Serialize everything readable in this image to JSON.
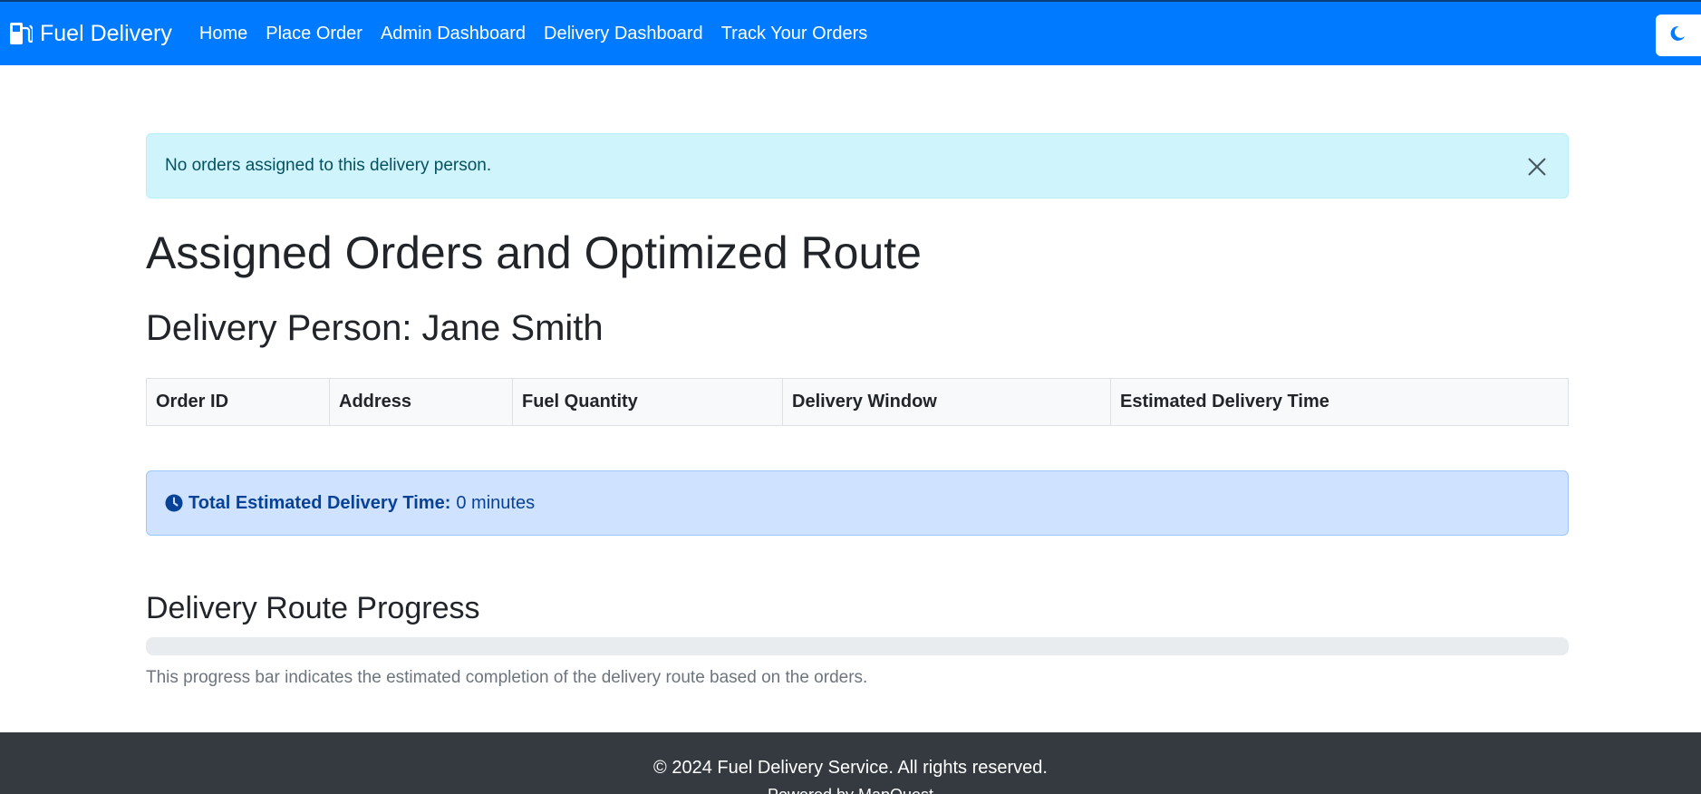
{
  "navbar": {
    "brand": "Fuel Delivery",
    "brand_icon": "gas-pump-icon",
    "links": [
      "Home",
      "Place Order",
      "Admin Dashboard",
      "Delivery Dashboard",
      "Track Your Orders"
    ],
    "theme_icon": "moon-icon",
    "color": "#007bff"
  },
  "alert": {
    "message": "No orders assigned to this delivery person.",
    "close_icon": "close-icon"
  },
  "page": {
    "title": "Assigned Orders and Optimized Route",
    "delivery_person_label": "Delivery Person: Jane Smith"
  },
  "table": {
    "headers": [
      "Order ID",
      "Address",
      "Fuel Quantity",
      "Delivery Window",
      "Estimated Delivery Time"
    ],
    "rows": []
  },
  "summary": {
    "icon": "clock-icon",
    "label": "Total Estimated Delivery Time:",
    "value": "0 minutes"
  },
  "progress": {
    "title": "Delivery Route Progress",
    "percent": 0,
    "note": "This progress bar indicates the estimated completion of the delivery route based on the orders."
  },
  "footer": {
    "copyright": "© 2024 Fuel Delivery Service. All rights reserved.",
    "extra": "Powered by MapQuest"
  }
}
